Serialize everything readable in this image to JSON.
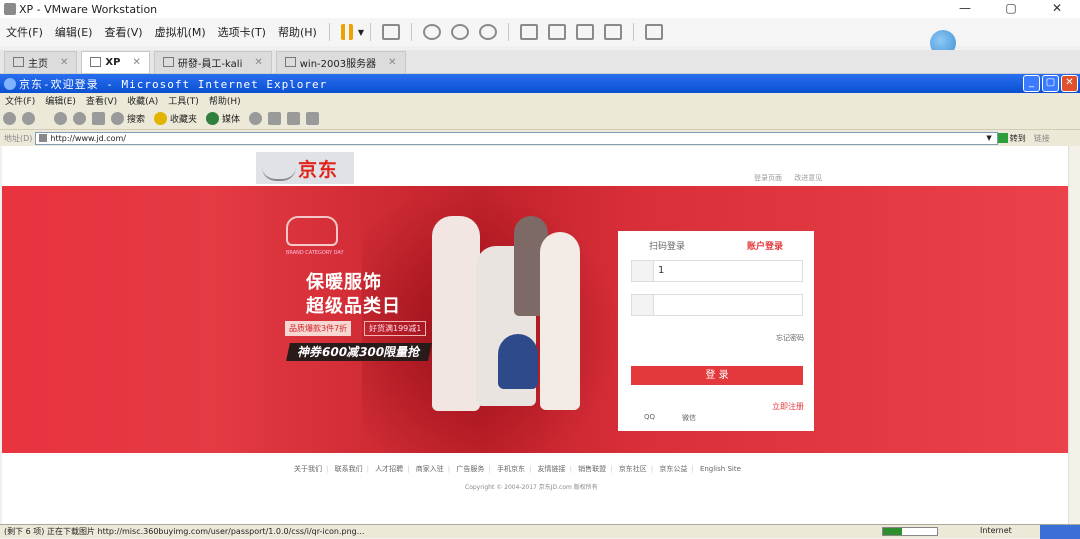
{
  "vmware": {
    "title": "XP - VMware Workstation",
    "menus": [
      "文件(F)",
      "编辑(E)",
      "查看(V)",
      "虚拟机(M)",
      "选项卡(T)",
      "帮助(H)"
    ],
    "tabs": [
      {
        "label": "主页",
        "active": false
      },
      {
        "label": "XP",
        "active": true
      },
      {
        "label": "研發-員工-kali",
        "active": false
      },
      {
        "label": "win-2003服务器",
        "active": false
      }
    ]
  },
  "ie": {
    "title": "京东-欢迎登录 - Microsoft Internet Explorer",
    "menus": [
      "文件(F)",
      "编辑(E)",
      "查看(V)",
      "收藏(A)",
      "工具(T)",
      "帮助(H)"
    ],
    "toolbar": {
      "search_label": "搜索",
      "favorites_label": "收藏夹",
      "media_label": "媒体"
    },
    "address_label": "地址(D)",
    "address": "http://www.jd.com/",
    "go_label": "转到",
    "links_label": "链接",
    "status_text": "(剩下 6 项) 正在下载图片 http://misc.360buyimg.com/user/passport/1.0.0/css/i/qr-icon.png...",
    "progress": 0.35,
    "zone_text": "Internet"
  },
  "page": {
    "logo_text": "京东",
    "top_links": [
      "登录页面",
      "改进意见"
    ],
    "promo": {
      "logo_sub": "BRAND CATEGORY DAY",
      "title_line1": "保暖服饰",
      "title_line2": "超级品类日",
      "tag1": "品质爆款3件7折",
      "tag2": "好货满199减1",
      "coupon": "神券600减300限量抢"
    },
    "login": {
      "tab_qr": "扫码登录",
      "tab_account": "账户登录",
      "username_value": "1",
      "forgot": "忘记密码",
      "submit": "登 录",
      "qq": "QQ",
      "wechat": "微信",
      "register": "立即注册"
    },
    "footer_links": [
      "关于我们",
      "联系我们",
      "人才招聘",
      "商家入驻",
      "广告服务",
      "手机京东",
      "友情链接",
      "销售联盟",
      "京东社区",
      "京东公益",
      "English Site"
    ],
    "copyright": "Copyright © 2004-2017 京东JD.com 版权所有"
  }
}
